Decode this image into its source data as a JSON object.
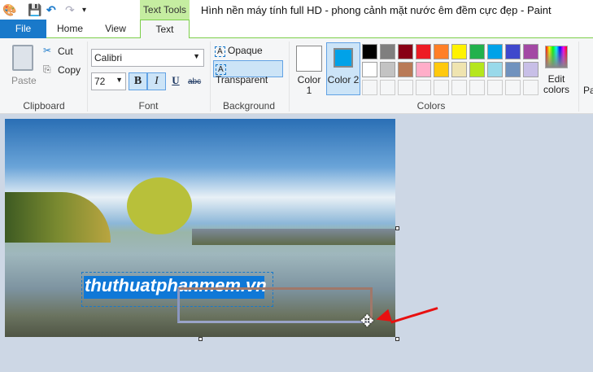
{
  "window": {
    "title": "Hình nền máy tính full HD - phong cảnh mặt nước êm đềm cực đẹp - Paint",
    "contextual_tab": "Text Tools"
  },
  "tabs": [
    {
      "label": "File"
    },
    {
      "label": "Home"
    },
    {
      "label": "View"
    },
    {
      "label": "Text"
    }
  ],
  "clipboard": {
    "paste": "Paste",
    "cut": "Cut",
    "copy": "Copy",
    "label": "Clipboard"
  },
  "font": {
    "family": "Calibri",
    "size": "72",
    "bold": "B",
    "italic": "I",
    "underline": "U",
    "strike": "abc",
    "label": "Font"
  },
  "background": {
    "opaque": "Opaque",
    "transparent": "Transparent",
    "label": "Background"
  },
  "colors": {
    "color1": "Color 1",
    "color2": "Color 2",
    "edit": "Edit colors",
    "label": "Colors",
    "color1_value": "#ffffff",
    "color2_value": "#00a2e8",
    "palette": [
      "#000000",
      "#7f7f7f",
      "#880015",
      "#ed1c24",
      "#ff7f27",
      "#fff200",
      "#22b14c",
      "#00a2e8",
      "#3f48cc",
      "#a349a4",
      "#ffffff",
      "#c3c3c3",
      "#b97a57",
      "#ffaec9",
      "#ffc90e",
      "#efe4b0",
      "#b5e61d",
      "#99d9ea",
      "#7092be",
      "#c8bfe7"
    ]
  },
  "next_group": "Pa",
  "canvas": {
    "text": "thuthuatphanmem.vn"
  }
}
